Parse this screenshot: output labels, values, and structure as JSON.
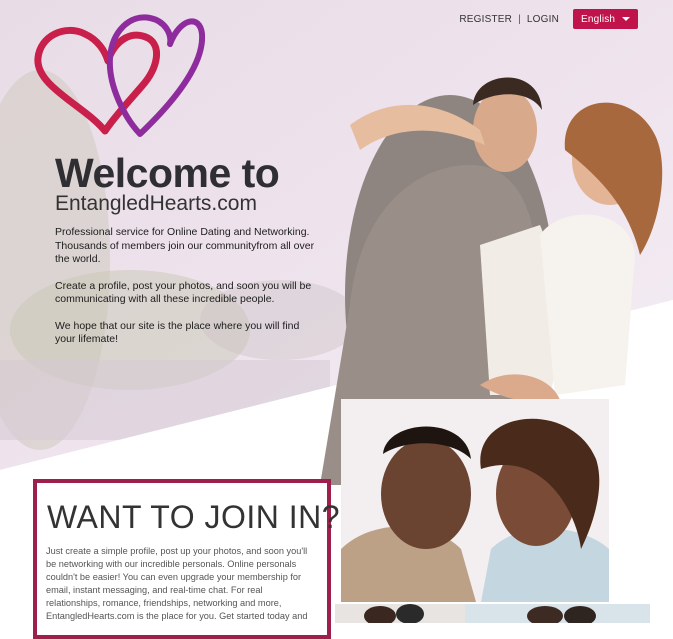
{
  "nav": {
    "register": "REGISTER",
    "separator": "|",
    "login": "LOGIN",
    "language": "English"
  },
  "logo": {
    "icon": "intertwined-hearts-logo"
  },
  "hero": {
    "title": "Welcome to",
    "site_name": "EntangledHearts.com",
    "paragraphs": [
      "Professional service for Online Dating and Networking. Thousands of members join our communityfrom all over the world.",
      "Create a profile, post your photos, and soon you will be communicating with all these incredible people.",
      "We hope that our site is the place where you will find your lifemate!"
    ]
  },
  "join": {
    "title": "WANT TO JOIN IN?",
    "text": "Just create a simple profile, post up your photos, and soon you'll be networking with our incredible personals. Online personals couldn't be easier! You can even upgrade your membership for email, instant messaging, and real-time chat. For real relationships, romance, friendships, networking and more, EntangledHearts.com is the place for you. Get started today and"
  },
  "colors": {
    "accent": "#c0134b",
    "heart_red": "#c8204a",
    "heart_purple": "#8e2c9e",
    "border": "#9e1f4b"
  }
}
